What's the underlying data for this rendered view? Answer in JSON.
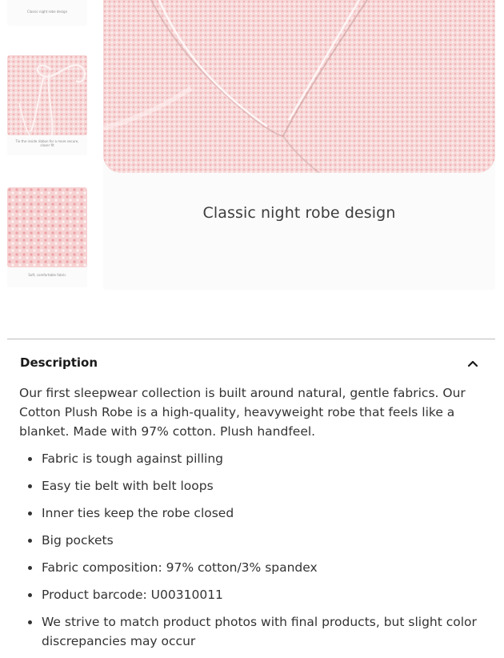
{
  "gallery": {
    "thumbnails": [
      {
        "caption": "Classic night robe design"
      },
      {
        "caption": "Tie the inside ribbon for a more secure, closer fit"
      },
      {
        "caption": "Soft, comfortable fabric"
      }
    ],
    "main_caption": "Classic night robe design"
  },
  "description": {
    "title": "Description",
    "paragraph": "Our first sleepwear collection is built around natural, gentle fabrics. Our Cotton Plush Robe is a high-quality, heavyweight robe that feels like a blanket. Made with 97% cotton. Plush handfeel.",
    "bullets": [
      "Fabric is tough against pilling",
      "Easy tie belt with belt loops",
      "Inner ties keep the robe closed",
      "Big pockets",
      "Fabric composition: 97% cotton/3% spandex",
      "Product barcode: U00310011",
      "We strive to match product photos with final products, but slight color discrepancies may occur"
    ]
  },
  "colors": {
    "robe_pink": "#f6d2d2",
    "weave_accent": "#e8828a",
    "divider": "#bdbdbd"
  },
  "icons": {
    "collapse": "chevron-up-icon"
  }
}
